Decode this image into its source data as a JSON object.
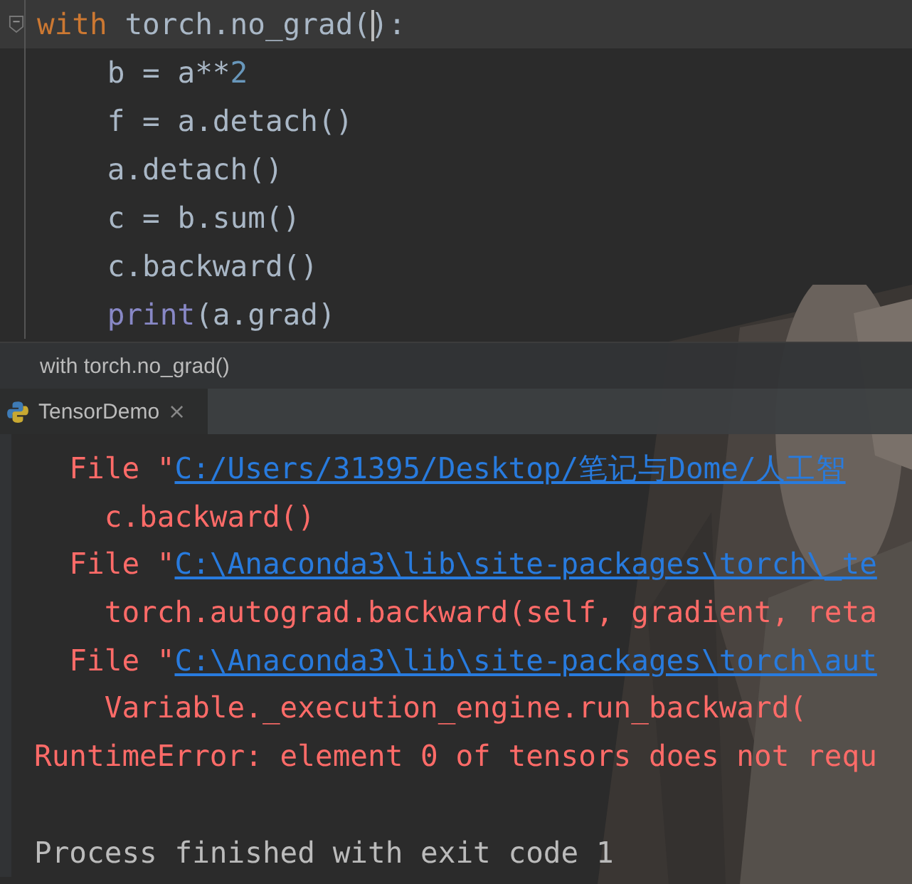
{
  "editor": {
    "lines": [
      {
        "current": true,
        "folded": false,
        "tokens": [
          {
            "kind": "keyword",
            "text": "with"
          },
          {
            "kind": "plain",
            "text": " torch.no_grad("
          },
          {
            "kind": "plain",
            "text": "):",
            "caret_before": true
          }
        ],
        "children": [
          {
            "current": false,
            "tokens": [
              {
                "kind": "plain",
                "text": "b = a**"
              },
              {
                "kind": "number",
                "text": "2"
              }
            ]
          },
          {
            "current": false,
            "tokens": [
              {
                "kind": "plain",
                "text": "f = a.detach()"
              }
            ]
          },
          {
            "current": false,
            "tokens": [
              {
                "kind": "plain",
                "text": "a.detach()"
              }
            ]
          },
          {
            "current": false,
            "tokens": [
              {
                "kind": "plain",
                "text": "c = b.sum()"
              }
            ]
          },
          {
            "current": false,
            "tokens": [
              {
                "kind": "plain",
                "text": "c.backward()"
              }
            ]
          },
          {
            "current": false,
            "tokens": [
              {
                "kind": "builtin",
                "text": "print"
              },
              {
                "kind": "plain",
                "text": "(a.grad)"
              }
            ]
          }
        ]
      }
    ]
  },
  "breadcrumb": "with torch.no_grad()",
  "run_tab": {
    "label": "TensorDemo",
    "close": "×",
    "selected": true
  },
  "console": {
    "lines": [
      {
        "kind": "frame",
        "segments": [
          {
            "kind": "error",
            "text": "File \""
          },
          {
            "kind": "link",
            "text": "C:/Users/31395/Desktop/笔记与Dome/人工智"
          }
        ],
        "children": [
          {
            "segments": [
              {
                "kind": "error",
                "text": "c.backward()"
              }
            ]
          }
        ]
      },
      {
        "kind": "frame",
        "segments": [
          {
            "kind": "error",
            "text": "File \""
          },
          {
            "kind": "link",
            "text": "C:\\Anaconda3\\lib\\site-packages\\torch\\_te"
          }
        ],
        "children": [
          {
            "segments": [
              {
                "kind": "error",
                "text": "torch.autograd.backward(self, gradient, reta"
              }
            ]
          }
        ]
      },
      {
        "kind": "frame",
        "segments": [
          {
            "kind": "error",
            "text": "File \""
          },
          {
            "kind": "link",
            "text": "C:\\Anaconda3\\lib\\site-packages\\torch\\aut"
          }
        ],
        "children": [
          {
            "segments": [
              {
                "kind": "error",
                "text": "Variable._execution_engine.run_backward("
              }
            ]
          }
        ]
      },
      {
        "kind": "error",
        "segments": [
          {
            "kind": "error",
            "text": "RuntimeError: element 0 of tensors does not requ"
          }
        ]
      },
      {
        "kind": "exit",
        "segments": [
          {
            "kind": "plain",
            "text": "Process finished with exit code 1"
          }
        ]
      }
    ]
  }
}
